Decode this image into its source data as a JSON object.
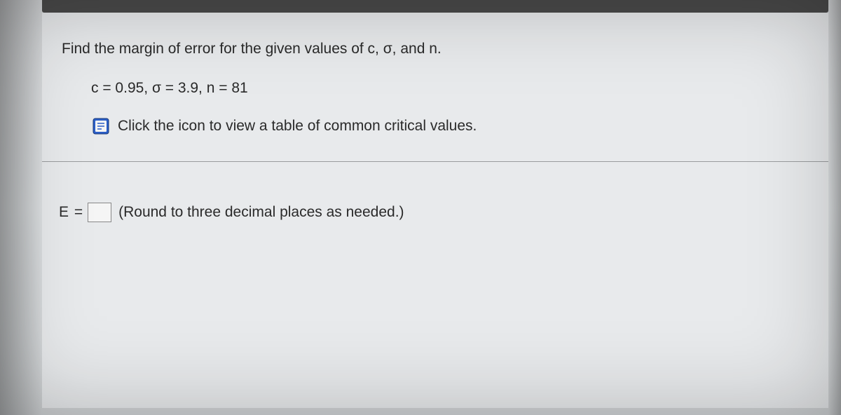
{
  "question": {
    "prompt": "Find the margin of error for the given values of c, σ, and n.",
    "given": "c = 0.95, σ = 3.9, n = 81",
    "link_text": "Click the icon to view a table of common critical values."
  },
  "answer": {
    "label": "E =",
    "value": "",
    "hint": "(Round to three decimal places as needed.)"
  }
}
